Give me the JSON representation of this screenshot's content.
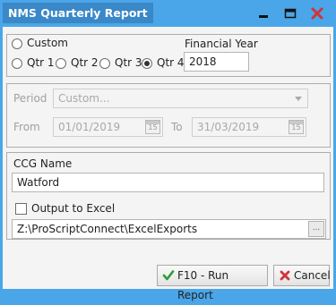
{
  "window": {
    "title": "NMS Quarterly Report",
    "accent": "#4aa6e8",
    "close_color": "#d0343a"
  },
  "period_selector": {
    "custom_label": "Custom",
    "quarters": [
      {
        "label": "Qtr 1",
        "selected": false
      },
      {
        "label": "Qtr 2",
        "selected": false
      },
      {
        "label": "Qtr 3",
        "selected": false
      },
      {
        "label": "Qtr 4",
        "selected": true
      }
    ],
    "financial_year_label": "Financial Year",
    "financial_year_value": "2018"
  },
  "date_range": {
    "period_label": "Period",
    "period_value": "Custom...",
    "from_label": "From",
    "from_value": "01/01/2019",
    "to_label": "To",
    "to_value": "31/03/2019",
    "calendar_day": "15"
  },
  "options": {
    "ccg_label": "CCG Name",
    "ccg_value": "Watford",
    "output_excel_label": "Output to Excel",
    "output_excel_checked": false,
    "export_path": "Z:\\ProScriptConnect\\ExcelExports",
    "browse_label": "..."
  },
  "actions": {
    "run_label": "F10 - Run Report",
    "cancel_label": "Cancel"
  }
}
